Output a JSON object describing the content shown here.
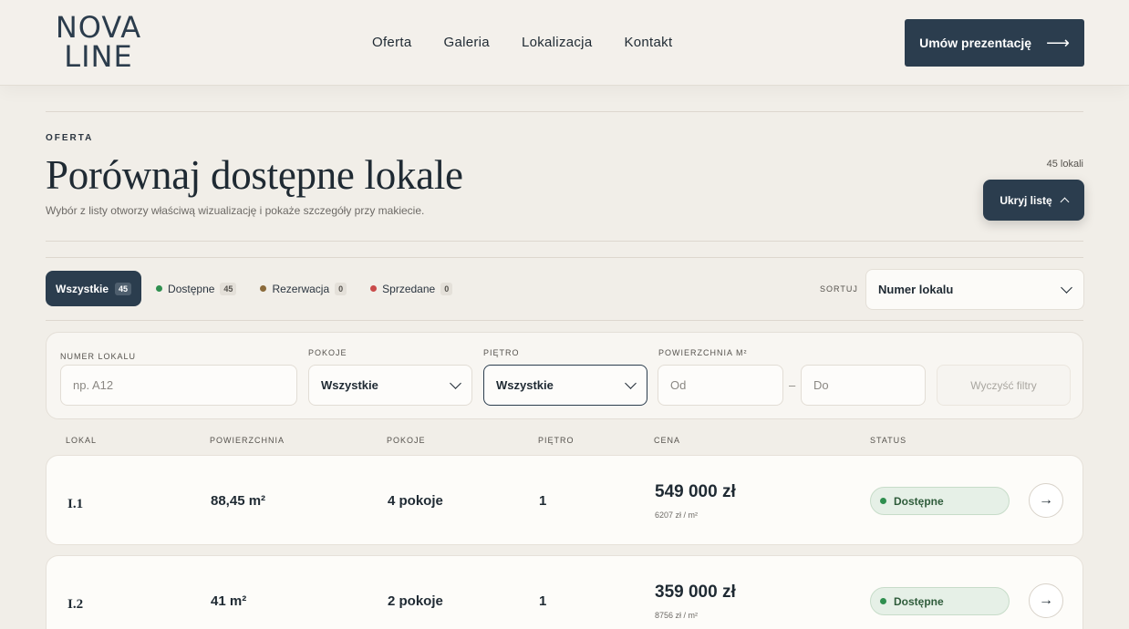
{
  "header": {
    "logo_line1": "NOVA",
    "logo_line2": "LINE",
    "nav": [
      "Oferta",
      "Galeria",
      "Lokalizacja",
      "Kontakt"
    ],
    "cta_label": "Umów prezentację",
    "cta_icon": "arrow-right-icon"
  },
  "section": {
    "eyebrow": "OFERTA",
    "title": "Porównaj dostępne lokale",
    "subtitle": "Wybór z listy otworzy właściwą wizualizację i pokaże szczegóły przy makiecie.",
    "count": "45 lokali",
    "hide_label": "Ukryj listę"
  },
  "tabs": [
    {
      "label": "Wszystkie",
      "count": "45"
    },
    {
      "label": "Dostępne",
      "count": "45",
      "color": "#2f8f4f"
    },
    {
      "label": "Rezerwacja",
      "count": "0",
      "color": "#8a6a3a"
    },
    {
      "label": "Sprzedane",
      "count": "0",
      "color": "#c94a4a"
    }
  ],
  "sort": {
    "label": "SORTUJ",
    "value": "Numer lokalu"
  },
  "filters": {
    "number_label": "NUMER LOKALU",
    "number_placeholder": "np. A12",
    "rooms_label": "POKOJE",
    "rooms_value": "Wszystkie",
    "floor_label": "PIĘTRO",
    "floor_value": "Wszystkie",
    "area_label": "POWIERZCHNIA M²",
    "area_from_placeholder": "Od",
    "area_to_placeholder": "Do",
    "area_dash": "–",
    "clear_label": "Wyczyść filtry"
  },
  "table": {
    "headers": [
      "LOKAL",
      "POWIERZCHNIA",
      "POKOJE",
      "PIĘTRO",
      "CENA",
      "STATUS"
    ],
    "rows": [
      {
        "lokal": "I.1",
        "area": "88,45 m²",
        "rooms": "4 pokoje",
        "floor": "1",
        "price": "549 000 zł",
        "ppm": "6207 zł / m²",
        "status": "Dostępne"
      },
      {
        "lokal": "I.2",
        "area": "41 m²",
        "rooms": "2 pokoje",
        "floor": "1",
        "price": "359 000 zł",
        "ppm": "8756 zł / m²",
        "status": "Dostępne"
      }
    ]
  },
  "colors": {
    "accent": "#2b3d4e",
    "available": "#2f8f4f"
  }
}
